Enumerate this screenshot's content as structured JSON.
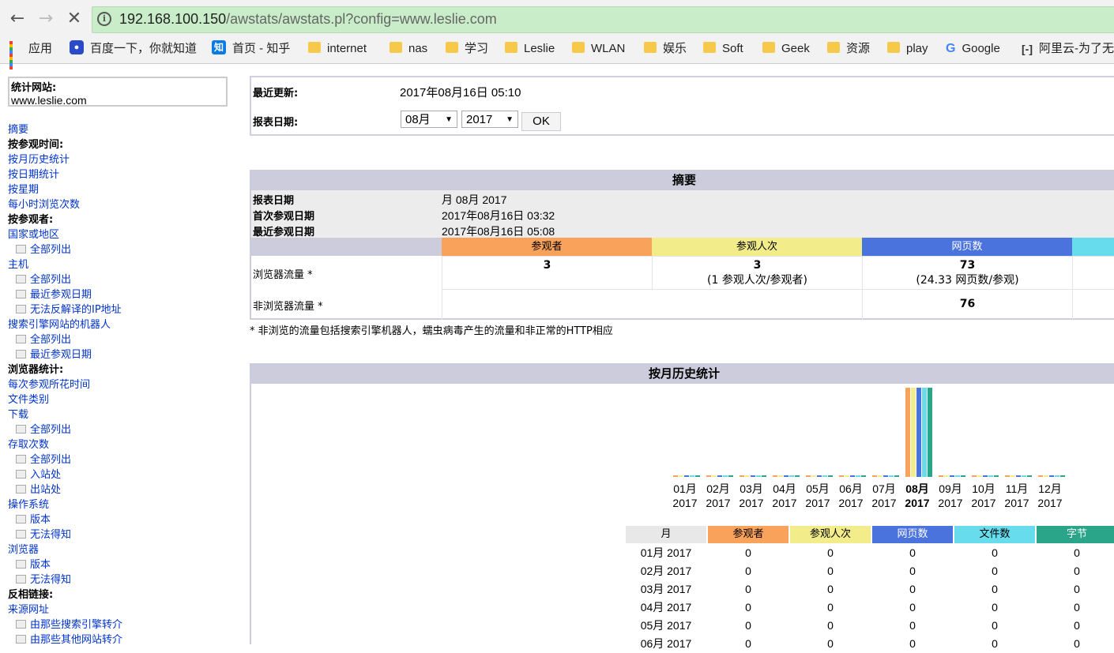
{
  "browser": {
    "url_host": "192.168.100.150",
    "url_path": "/awstats/awstats.pl?config=www.leslie.com",
    "bookmarks": [
      "应用",
      "百度一下，你就知道",
      "首页 - 知乎",
      "internet",
      "nas",
      "学习",
      "Leslie",
      "WLAN",
      "娱乐",
      "Soft",
      "Geek",
      "资源",
      "play",
      "Google",
      "阿里云-为了无"
    ]
  },
  "sidebar": {
    "site_label": "统计网站:",
    "site_value": "www.leslie.com",
    "items": [
      {
        "type": "link",
        "label": "摘要"
      },
      {
        "type": "header",
        "label": "按参观时间:"
      },
      {
        "type": "link",
        "label": "按月历史统计"
      },
      {
        "type": "link",
        "label": "按日期统计"
      },
      {
        "type": "link",
        "label": "按星期"
      },
      {
        "type": "link",
        "label": "每小时浏览次数"
      },
      {
        "type": "header",
        "label": "按参观者:"
      },
      {
        "type": "link",
        "label": "国家或地区"
      },
      {
        "type": "sub",
        "label": "全部列出"
      },
      {
        "type": "link",
        "label": "主机"
      },
      {
        "type": "sub",
        "label": "全部列出"
      },
      {
        "type": "sub",
        "label": "最近参观日期"
      },
      {
        "type": "sub",
        "label": "无法反解译的IP地址"
      },
      {
        "type": "link",
        "label": "搜索引擎网站的机器人"
      },
      {
        "type": "sub",
        "label": "全部列出"
      },
      {
        "type": "sub",
        "label": "最近参观日期"
      },
      {
        "type": "header",
        "label": "浏览器统计:"
      },
      {
        "type": "link",
        "label": "每次参观所花时间"
      },
      {
        "type": "link",
        "label": "文件类别"
      },
      {
        "type": "link",
        "label": "下载"
      },
      {
        "type": "sub",
        "label": "全部列出"
      },
      {
        "type": "link",
        "label": "存取次数"
      },
      {
        "type": "sub",
        "label": "全部列出"
      },
      {
        "type": "sub",
        "label": "入站处"
      },
      {
        "type": "sub",
        "label": "出站处"
      },
      {
        "type": "link",
        "label": "操作系统"
      },
      {
        "type": "sub",
        "label": "版本"
      },
      {
        "type": "sub",
        "label": "无法得知"
      },
      {
        "type": "link",
        "label": "浏览器"
      },
      {
        "type": "sub",
        "label": "版本"
      },
      {
        "type": "sub",
        "label": "无法得知"
      },
      {
        "type": "header",
        "label": "反相链接:"
      },
      {
        "type": "link",
        "label": "来源网址"
      },
      {
        "type": "sub",
        "label": "由那些搜索引擎转介"
      },
      {
        "type": "sub",
        "label": "由那些其他网站转介"
      }
    ]
  },
  "info": {
    "last_update_label": "最近更新:",
    "last_update_value": "2017年08月16日 05:10",
    "report_date_label": "报表日期:",
    "month_select": "08月",
    "year_select": "2017",
    "ok_label": "OK"
  },
  "summary": {
    "title": "摘要",
    "rows": [
      {
        "label": "报表日期",
        "value": "月 08月 2017"
      },
      {
        "label": "首次参观日期",
        "value": "2017年08月16日 03:32"
      },
      {
        "label": "最近参观日期",
        "value": "2017年08月16日 05:08"
      }
    ],
    "columns": [
      "参观者",
      "参观人次",
      "网页数"
    ],
    "browser_row": {
      "label": "浏览器流量 *",
      "visitors": "3",
      "visits": "3",
      "visits_note": "(1 参观人次/参观者)",
      "pages": "73",
      "pages_note": "(24.33 网页数/参观)"
    },
    "nonbrowser_row": {
      "label": "非浏览器流量 *",
      "pages": "76"
    },
    "footnote": "* 非浏览的流量包括搜索引擎机器人，蠕虫病毒产生的流量和非正常的HTTP相应"
  },
  "history": {
    "title": "按月历史统计",
    "table_headers": [
      "月",
      "参观者",
      "参观人次",
      "网页数",
      "文件数",
      "字节"
    ],
    "rows": [
      {
        "month": "01月 2017",
        "values": [
          "0",
          "0",
          "0",
          "0",
          "0"
        ]
      },
      {
        "month": "02月 2017",
        "values": [
          "0",
          "0",
          "0",
          "0",
          "0"
        ]
      },
      {
        "month": "03月 2017",
        "values": [
          "0",
          "0",
          "0",
          "0",
          "0"
        ]
      },
      {
        "month": "04月 2017",
        "values": [
          "0",
          "0",
          "0",
          "0",
          "0"
        ]
      },
      {
        "month": "05月 2017",
        "values": [
          "0",
          "0",
          "0",
          "0",
          "0"
        ]
      },
      {
        "month": "06月 2017",
        "values": [
          "0",
          "0",
          "0",
          "0",
          "0"
        ]
      }
    ]
  },
  "colors": {
    "visitors": "#f9a25b",
    "visits": "#f2ec8a",
    "pages": "#4a73dd",
    "hits": "#66dcec",
    "bytes": "#2aa58a",
    "header_bg": "#ccccdd",
    "link": "#0033cc"
  },
  "chart_data": {
    "type": "bar",
    "categories": [
      "01月 2017",
      "02月 2017",
      "03月 2017",
      "04月 2017",
      "05月 2017",
      "06月 2017",
      "07月 2017",
      "08月 2017",
      "09月 2017",
      "10月 2017",
      "11月 2017",
      "12月 2017"
    ],
    "series": [
      {
        "name": "参观者",
        "values": [
          0,
          0,
          0,
          0,
          0,
          0,
          0,
          3,
          0,
          0,
          0,
          0
        ]
      },
      {
        "name": "参观人次",
        "values": [
          0,
          0,
          0,
          0,
          0,
          0,
          0,
          3,
          0,
          0,
          0,
          0
        ]
      },
      {
        "name": "网页数",
        "values": [
          0,
          0,
          0,
          0,
          0,
          0,
          0,
          73,
          0,
          0,
          0,
          0
        ]
      },
      {
        "name": "文件数",
        "values": [
          0,
          0,
          0,
          0,
          0,
          0,
          0,
          73,
          0,
          0,
          0,
          0
        ]
      },
      {
        "name": "字节",
        "values": [
          0,
          0,
          0,
          0,
          0,
          0,
          0,
          1,
          0,
          0,
          0,
          0
        ]
      }
    ],
    "month_labels": [
      "01月",
      "02月",
      "03月",
      "04月",
      "05月",
      "06月",
      "07月",
      "08月",
      "09月",
      "10月",
      "11月",
      "12月"
    ],
    "year_label": "2017",
    "highlight_index": 7
  }
}
